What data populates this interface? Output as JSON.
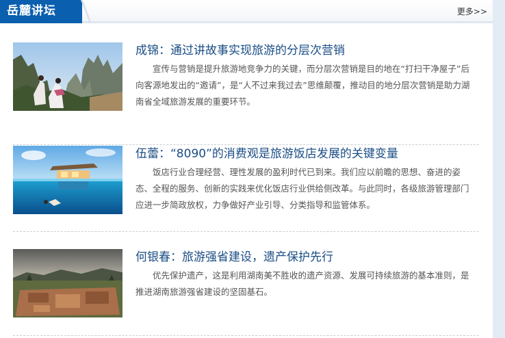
{
  "header": {
    "title": "岳麓讲坛",
    "more_label": "更多",
    "more_arrows": ">>"
  },
  "articles": [
    {
      "title": "成锦：通过讲故事实现旅游的分层次营销",
      "summary": "宣传与营销是提升旅游地竞争力的关键，而分层次营销是目的地在“打扫干净屋子”后向客源地发出的“邀请”，是“人不过来我过去”思维颠覆，推动目的地分层次营销是助力湖南省全域旅游发展的重要环节。",
      "image_icon": "mountain-scenery"
    },
    {
      "title": "伍蕾：“8090”的消费观是旅游饭店发展的关键变量",
      "summary": "饭店行业合理经营、理性发展的盈利时代已到来。我们应以前瞻的思想、奋进的姿态、全程的服务、创新的实践来优化饭店行业供给侧改革。与此同时，各级旅游管理部门应进一步简政放权，力争做好产业引导、分类指导和监管体系。",
      "image_icon": "ocean-hotel"
    },
    {
      "title": "何银春：旅游强省建设，遗产保护先行",
      "summary": "优先保护遗产，这是利用湖南美不胜收的遗产资源、发展可持续旅游的基本准则，是推进湖南旅游强省建设的坚固基石。",
      "image_icon": "heritage-site"
    }
  ],
  "colors": {
    "brand_blue": "#0a5fae",
    "title_blue": "#1a4d85",
    "summary_gray": "#555555"
  }
}
